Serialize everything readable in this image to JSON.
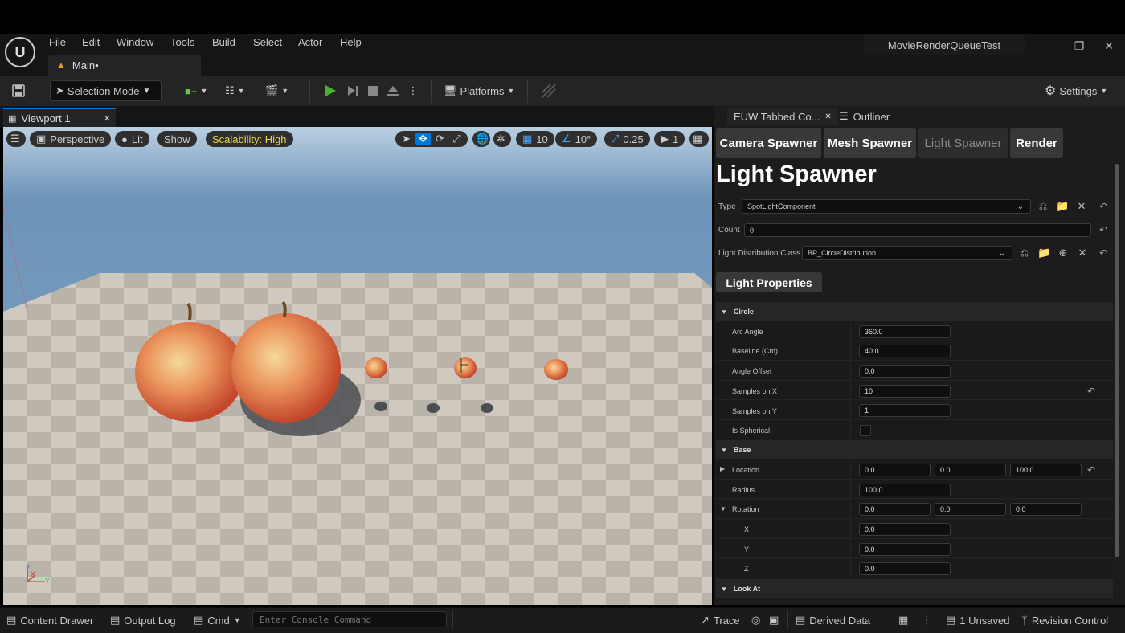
{
  "app": {
    "project_title": "MovieRenderQueueTest",
    "level_tab": "Main•",
    "logo_letter": "U"
  },
  "menu": [
    "File",
    "Edit",
    "Window",
    "Tools",
    "Build",
    "Select",
    "Actor",
    "Help"
  ],
  "toolbar": {
    "selection_mode": "Selection Mode",
    "platforms": "Platforms",
    "settings": "Settings"
  },
  "viewport": {
    "tab_label": "Viewport 1",
    "perspective": "Perspective",
    "lit": "Lit",
    "show": "Show",
    "scalability": "Scalability: High",
    "grid_snap": "10",
    "rotation_snap": "10°",
    "scale_snap": "0.25",
    "camera_speed": "1",
    "axis_x": "X",
    "axis_y": "Y",
    "axis_z": "Z"
  },
  "right_panel": {
    "tab_euw": "EUW Tabbed Co...",
    "tab_outliner": "Outliner",
    "sub_tabs": [
      "Camera Spawner",
      "Mesh Spawner",
      "Light Spawner",
      "Render"
    ],
    "active_sub_tab": "Light Spawner",
    "heading": "Light Spawner",
    "type_label": "Type",
    "type_value": "SpotLightComponent",
    "count_label": "Count",
    "count_value": "0",
    "ldc_label": "Light Distribution Class",
    "ldc_value": "BP_CircleDistribution",
    "light_properties_button": "Light Properties",
    "sections": {
      "circle": "Circle",
      "base": "Base",
      "look_at": "Look At"
    },
    "circle_props": [
      {
        "name": "Arc Angle",
        "value": "360.0"
      },
      {
        "name": "Baseline (Cm)",
        "value": "40.0"
      },
      {
        "name": "Angle Offset",
        "value": "0.0"
      },
      {
        "name": "Samples on X",
        "value": "10"
      },
      {
        "name": "Samples on Y",
        "value": "1"
      },
      {
        "name": "Is Spherical",
        "value": ""
      }
    ],
    "base_props": {
      "location_label": "Location",
      "location": [
        "0.0",
        "0.0",
        "100.0"
      ],
      "radius_label": "Radius",
      "radius": "100.0",
      "rotation_label": "Rotation",
      "rotation": [
        "0.0",
        "0.0",
        "0.0"
      ],
      "rot_x_label": "X",
      "rot_x": "0.0",
      "rot_y_label": "Y",
      "rot_y": "0.0",
      "rot_z_label": "Z",
      "rot_z": "0.0"
    }
  },
  "statusbar": {
    "content_drawer": "Content Drawer",
    "output_log": "Output Log",
    "cmd": "Cmd",
    "console_placeholder": "Enter Console Command",
    "trace": "Trace",
    "derived_data": "Derived Data",
    "unsaved": "1 Unsaved",
    "revision_control": "Revision Control"
  },
  "colors": {
    "accent_blue": "#0078d7",
    "scalability_yellow": "#e8d44d",
    "play_green": "#4caf2e"
  }
}
